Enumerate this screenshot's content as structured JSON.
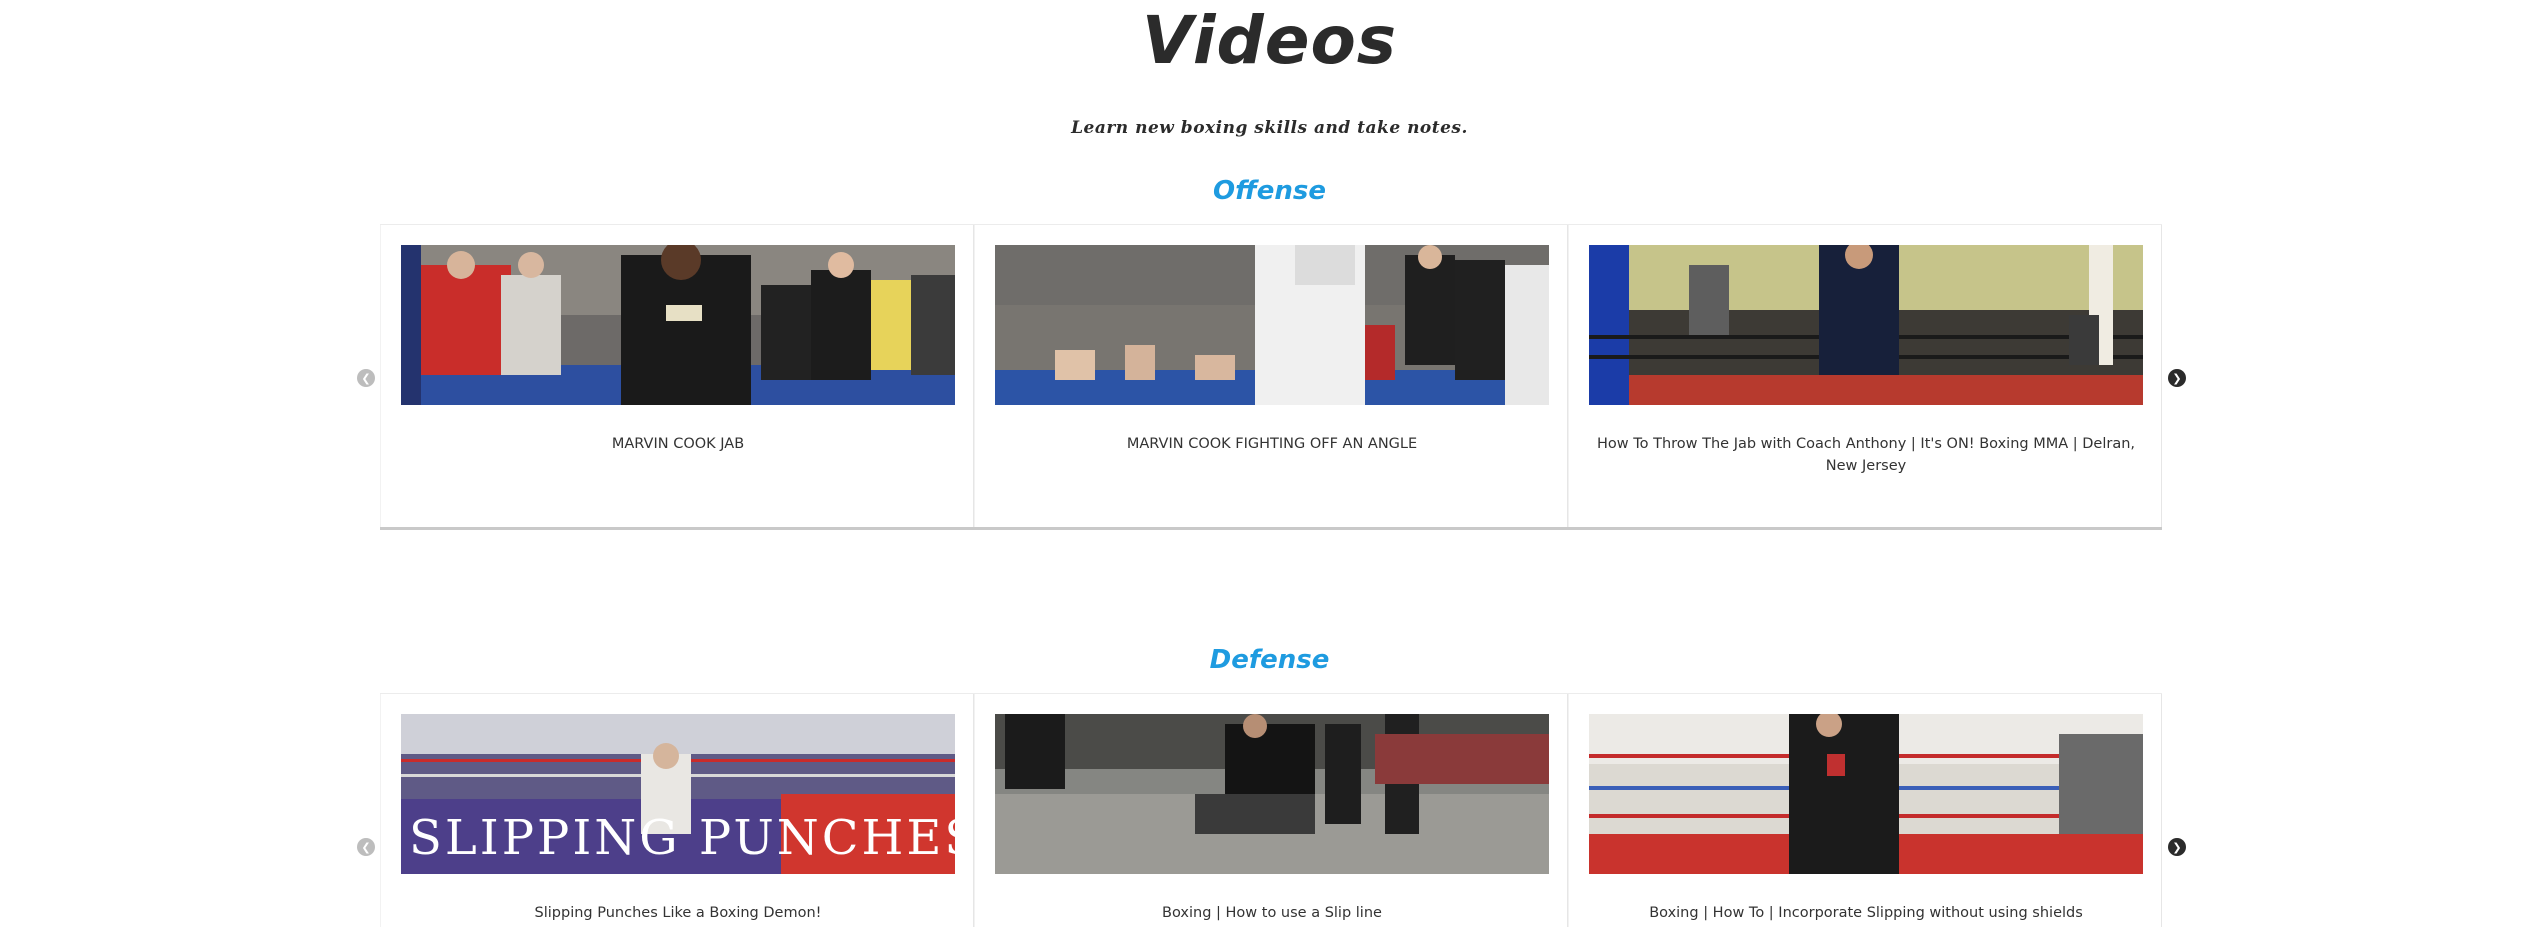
{
  "page": {
    "title": "Videos",
    "subtitle": "Learn new boxing skills and take notes."
  },
  "sections": [
    {
      "title": "Offense",
      "prev_icon": "chevron-left-icon",
      "next_icon": "chevron-right-icon",
      "prev_glyph": "❮",
      "next_glyph": "❯",
      "videos": [
        {
          "title": "MARVIN COOK JAB"
        },
        {
          "title": "MARVIN COOK FIGHTING OFF AN ANGLE"
        },
        {
          "title": "How To Throw The Jab with Coach Anthony | It's ON! Boxing MMA | Delran, New Jersey"
        }
      ]
    },
    {
      "title": "Defense",
      "prev_icon": "chevron-left-icon",
      "next_icon": "chevron-right-icon",
      "prev_glyph": "❮",
      "next_glyph": "❯",
      "videos": [
        {
          "title": "Slipping Punches Like a Boxing Demon!",
          "thumb_text": "SLIPPING PUNCHES"
        },
        {
          "title": "Boxing | How to use a Slip line"
        },
        {
          "title": "Boxing | How To | Incorporate Slipping without using shields"
        }
      ]
    }
  ],
  "colors": {
    "section_title": "#1e9be0",
    "heading": "#2b2b2b",
    "arrow_disabled": "#bdbdbd",
    "arrow_active": "#2b2b2b"
  }
}
